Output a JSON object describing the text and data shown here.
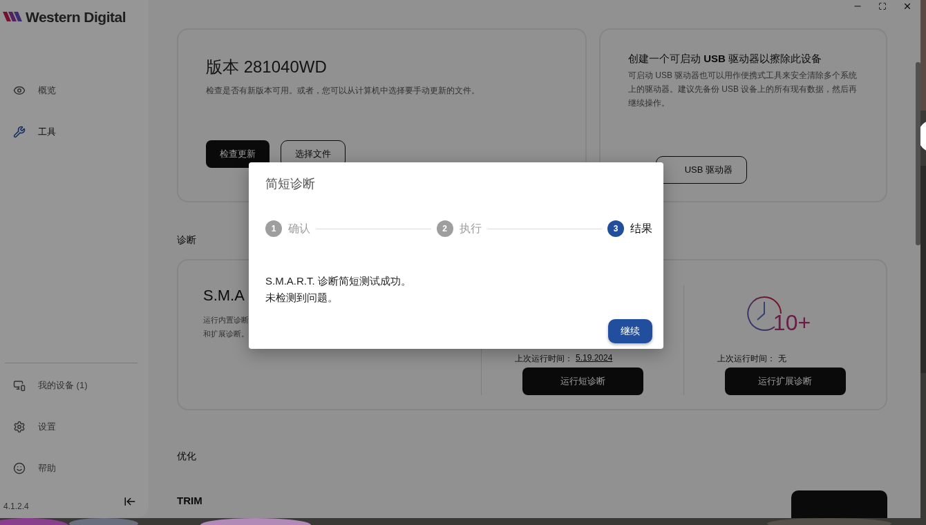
{
  "sidebar": {
    "logo": "Western Digital",
    "items": [
      {
        "label": "概览",
        "selected": false
      },
      {
        "label": "工具",
        "selected": true
      }
    ],
    "bottom_items": [
      {
        "label": "我的设备 (1)"
      },
      {
        "label": "设置"
      },
      {
        "label": "帮助"
      }
    ],
    "version": "4.1.2.4"
  },
  "firmware_card": {
    "title": "版本 281040WD",
    "description": "检查是否有新版本可用。或者，您可以从计算机中选择要手动更新的文件。",
    "buttons": [
      "检查更新",
      "选择文件"
    ]
  },
  "usb_card": {
    "title": "创建一个可启动 **USB** 驱动器以擦除此设备",
    "description": "可启动 USB 驱动器也可以用作便携式工具来安全清除多个系统上的驱动器。建议先备份 USB 设备上的所有现有数据，然后再继续操作。",
    "button": "USB 驱动器"
  },
  "diagnostics": {
    "heading": "诊断",
    "title": "S.M.A",
    "description_lines": [
      "运行内置诊断",
      "和扩展诊断。"
    ],
    "short": {
      "last_run_label": "上次运行时间：",
      "last_run_value": "5.19.2024",
      "button": "运行短诊断"
    },
    "extended": {
      "badge": "10+",
      "last_run_label": "上次运行时间：",
      "last_run_value": "无",
      "button": "运行扩展诊断"
    }
  },
  "optimization": {
    "heading": "优化",
    "item_title": "TRIM"
  },
  "dialog": {
    "title": "简短诊断",
    "steps": [
      {
        "number": "1",
        "label": "确认",
        "selected": false
      },
      {
        "number": "2",
        "label": "执行",
        "selected": false
      },
      {
        "number": "3",
        "label": "结果",
        "selected": true
      }
    ],
    "message_lines": [
      "S.M.A.R.T. 诊断简短测试成功。",
      "未检测到问题。"
    ],
    "button": "继续"
  }
}
